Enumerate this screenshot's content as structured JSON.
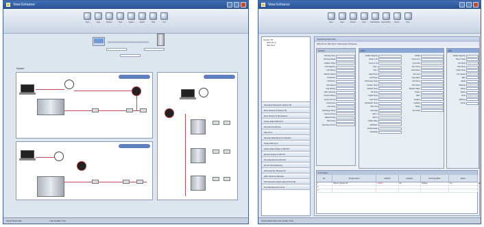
{
  "left_window": {
    "title": "View Enhance",
    "toolbar": [
      {
        "label": "Open",
        "icon": "open-icon"
      },
      {
        "label": "Save",
        "icon": "save-icon"
      },
      {
        "label": "Monitor",
        "icon": "monitor-icon"
      },
      {
        "label": "Tools",
        "icon": "tools-icon"
      },
      {
        "label": "System",
        "icon": "system-icon"
      },
      {
        "label": "Report",
        "icon": "report-icon"
      },
      {
        "label": "Help",
        "icon": "help-icon"
      },
      {
        "label": "Exit",
        "icon": "exit-icon"
      }
    ],
    "diagram_heading": "System",
    "status_left": "Serial Status Idle",
    "status_right": "Last Update Time"
  },
  "right_window": {
    "title": "View Enhance",
    "toolbar": [
      {
        "label": "Open",
        "icon": "open-icon"
      },
      {
        "label": "Save",
        "icon": "save-icon"
      },
      {
        "label": "Monitor",
        "icon": "monitor-icon"
      },
      {
        "label": "Tools",
        "icon": "tools-icon"
      },
      {
        "label": "Start Monitor",
        "icon": "start-icon"
      },
      {
        "label": "Stop Monitor",
        "icon": "stop-icon"
      },
      {
        "label": "Report",
        "icon": "report-icon"
      },
      {
        "label": "Help",
        "icon": "help-icon"
      }
    ],
    "tree": [
      "System 01",
      "ODU 01-0",
      "IDU 01-0"
    ],
    "nav": [
      "Operating Parameter System 00",
      "Error Record of System 00",
      "Error Record of All Systems",
      "Online Data ODU 01-0",
      "Pre-Fault Of Device",
      "Stop 01-0",
      "Operate Data Record of System",
      "Output IDU 01-0",
      "Online Data Output of IDU 00",
      "Record Output of IDU 00",
      "Pre-Fault Record 01-0 00",
      "M-I/O Commissioning",
      "IDU Fault Ten Minutes 00",
      "ODU Fault Ten Minutes",
      "IDU Reduced Output Record 01-0 00",
      "Pre-Fault Record of Unit"
    ],
    "pane_title": "Operating Parameter",
    "pane_path": "ODU 01-0 / IDU 01-0 / Parameter Of Device",
    "system_panel": {
      "title": "System",
      "rows": [
        "Running Time",
        "Running Mode",
        "Outdoor Temp",
        "Unit Capacity",
        "Unit Status",
        "Defrost Status",
        "Protection",
        "Oil Return",
        "Fan Speed",
        "Cap Setting",
        "EEV Opening",
        "Current Status",
        "Comp Current",
        "Comp Freq",
        "Avg Temp",
        "Discharge Temp",
        "Suction Press",
        "Rated Power",
        "Net Power",
        "Running Current"
      ]
    },
    "odu_panel": {
      "title": "ODU",
      "left_rows": [
        "Model Capacity",
        "Comp 1 Hz",
        "Comp 2 Hz",
        "Fan 1",
        "Fan 2",
        "High Press",
        "Low Press",
        "Discharge Temp",
        "Suction Temp",
        "Defrost Temp",
        "Oil Temp",
        "Liquid Temp",
        "Gas Temp",
        "Heat Exch Temp",
        "Sub Cool",
        "Sub Heat",
        "EXV 1",
        "EXV 2",
        "4-Way Valve",
        "Oil Return",
        "Crank Heater",
        "Unloading"
      ],
      "right_rows": [
        "Model",
        "Comp Cur",
        "Input Volt",
        "Env Temp",
        "Heat Temp",
        "Oil Level",
        "Cap Valve",
        "Out Temp",
        "Fan Temp",
        "Bypass Valve",
        "Power",
        "EEV",
        "Cooling",
        "Heating",
        "Mode",
        "Err Code"
      ]
    },
    "idu_panel": {
      "title": "IDU",
      "rows": [
        "Model Capacity",
        "Room Temp",
        "Set Temp",
        "Inlet Temp",
        "Outlet Temp",
        "Fan Speed",
        "EEV",
        "Mode",
        "Capacity",
        "Swing",
        "Status",
        "Error",
        "Address",
        "Group"
      ]
    },
    "table": {
      "title": "Unit Status",
      "headers": [
        "No.",
        "Project Name",
        "Address",
        "Capacity",
        "Running Mode",
        "Status",
        "Mode",
        "Set Temp",
        "Room",
        "Fan",
        "Error"
      ],
      "rows": [
        [
          "1",
          "Villa Air System 01",
          "Online",
          "22",
          "Cooling",
          "On",
          "Auto",
          "24",
          "26",
          "Hi",
          "--"
        ],
        [
          "2",
          "",
          "",
          "",
          "",
          "",
          "",
          "",
          "",
          "",
          ""
        ],
        [
          "3",
          "",
          "",
          "",
          "",
          "",
          "",
          "",
          "",
          "",
          ""
        ]
      ]
    },
    "status_text": "Serial Status Idle  Last Update Time"
  }
}
